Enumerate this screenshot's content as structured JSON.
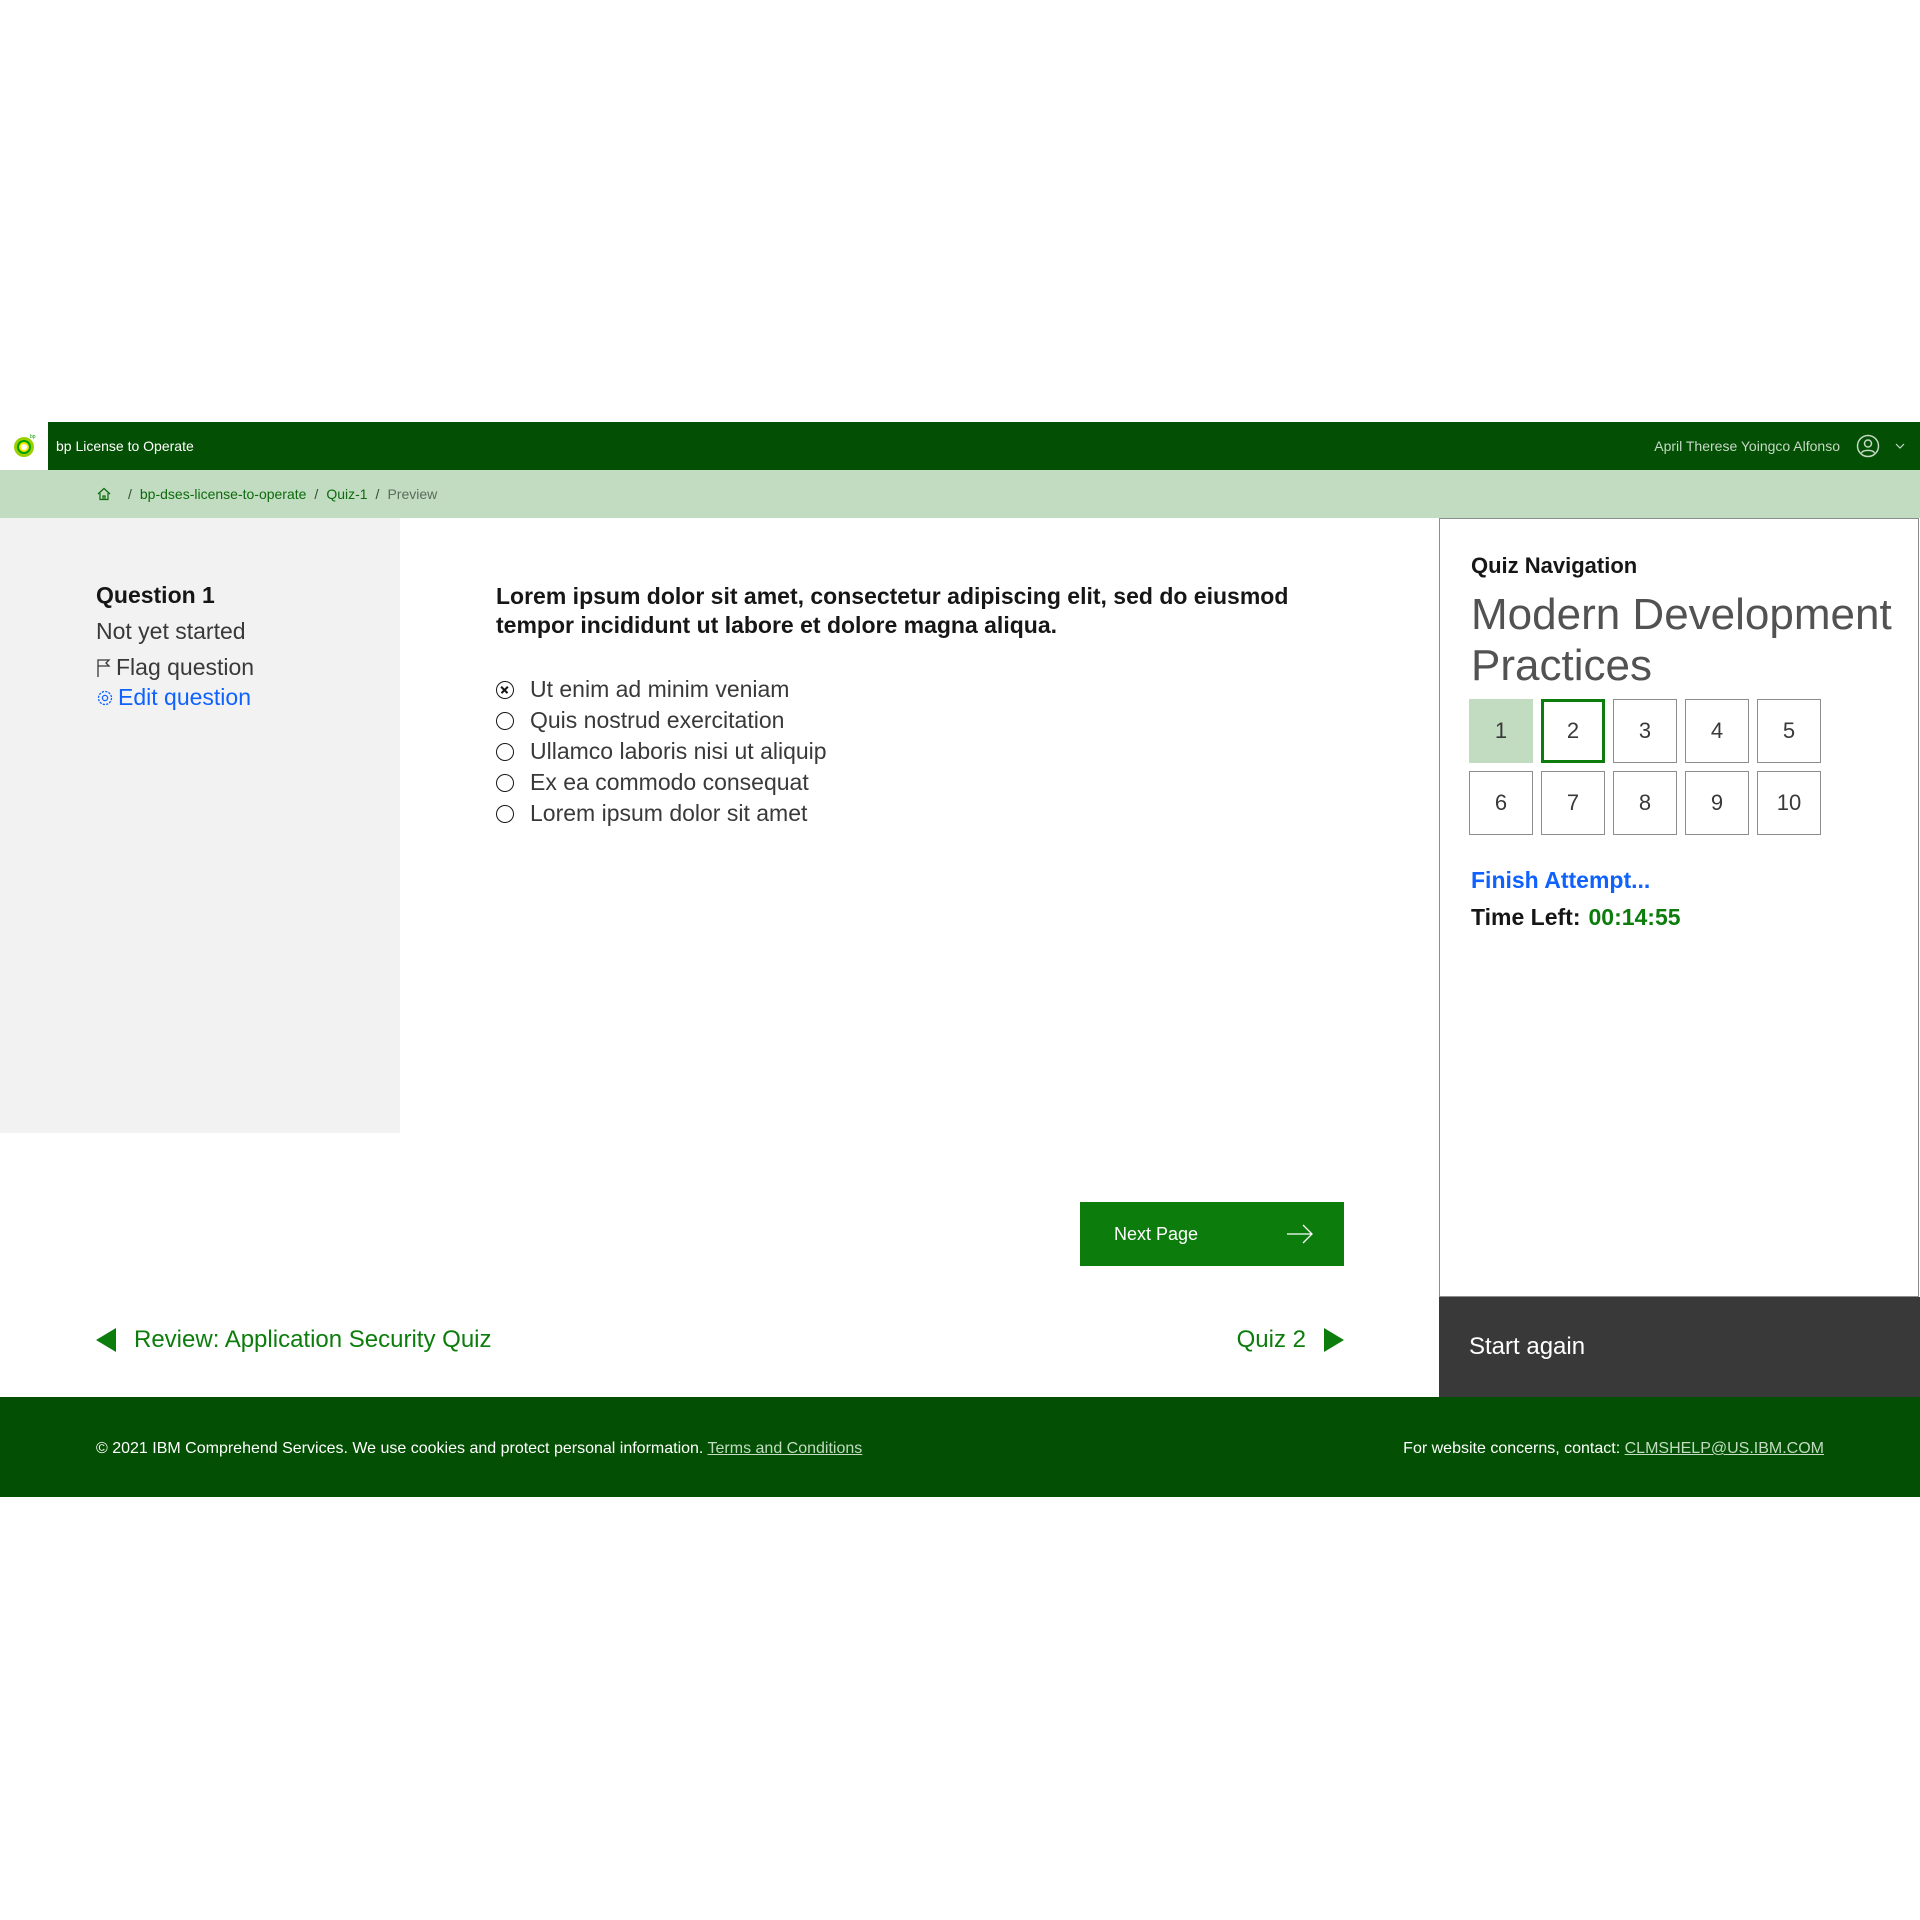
{
  "header": {
    "app_name": "bp License to Operate",
    "user_name": "April Therese Yoingco Alfonso",
    "brand_color": "#034f03",
    "logo_icon": "bp-helios-icon",
    "user_icon": "user-avatar-icon",
    "menu_icon": "chevron-down-icon"
  },
  "breadcrumb": {
    "home_icon": "home-icon",
    "items": [
      "bp-dses-license-to-operate",
      "Quiz-1",
      "Preview"
    ]
  },
  "question_info": {
    "title": "Question 1",
    "status": "Not yet started",
    "flag_label": "Flag question",
    "edit_label": "Edit question"
  },
  "question": {
    "text": "Lorem ipsum dolor sit amet, consectetur adipiscing elit, sed do eiusmod tempor incididunt ut labore et dolore magna aliqua.",
    "answers": [
      "Ut enim ad minim veniam",
      "Quis nostrud exercitation",
      "Ullamco laboris nisi ut aliquip",
      "Ex ea commodo consequat",
      "Lorem ipsum dolor sit amet"
    ]
  },
  "actions": {
    "next_page": "Next Page"
  },
  "pager": {
    "prev": "Review: Application Security Quiz",
    "next": "Quiz 2"
  },
  "quiz_nav": {
    "label": "Quiz Navigation",
    "course": "Modern Development Practices",
    "pages": [
      "1",
      "2",
      "3",
      "4",
      "5",
      "6",
      "7",
      "8",
      "9",
      "10"
    ],
    "answered_page": "1",
    "current_page": "2",
    "finish_label": "Finish Attempt...",
    "time_label": "Time Left:",
    "time_value": "00:14:55",
    "start_again": "Start again"
  },
  "footer": {
    "copyright": "© 2021 IBM Comprehend Services. We use cookies and protect personal information.",
    "terms_link": "Terms and Conditions",
    "contact_label": "For website concerns, contact:",
    "contact_email": "CLMSHELP@US.IBM.COM"
  }
}
